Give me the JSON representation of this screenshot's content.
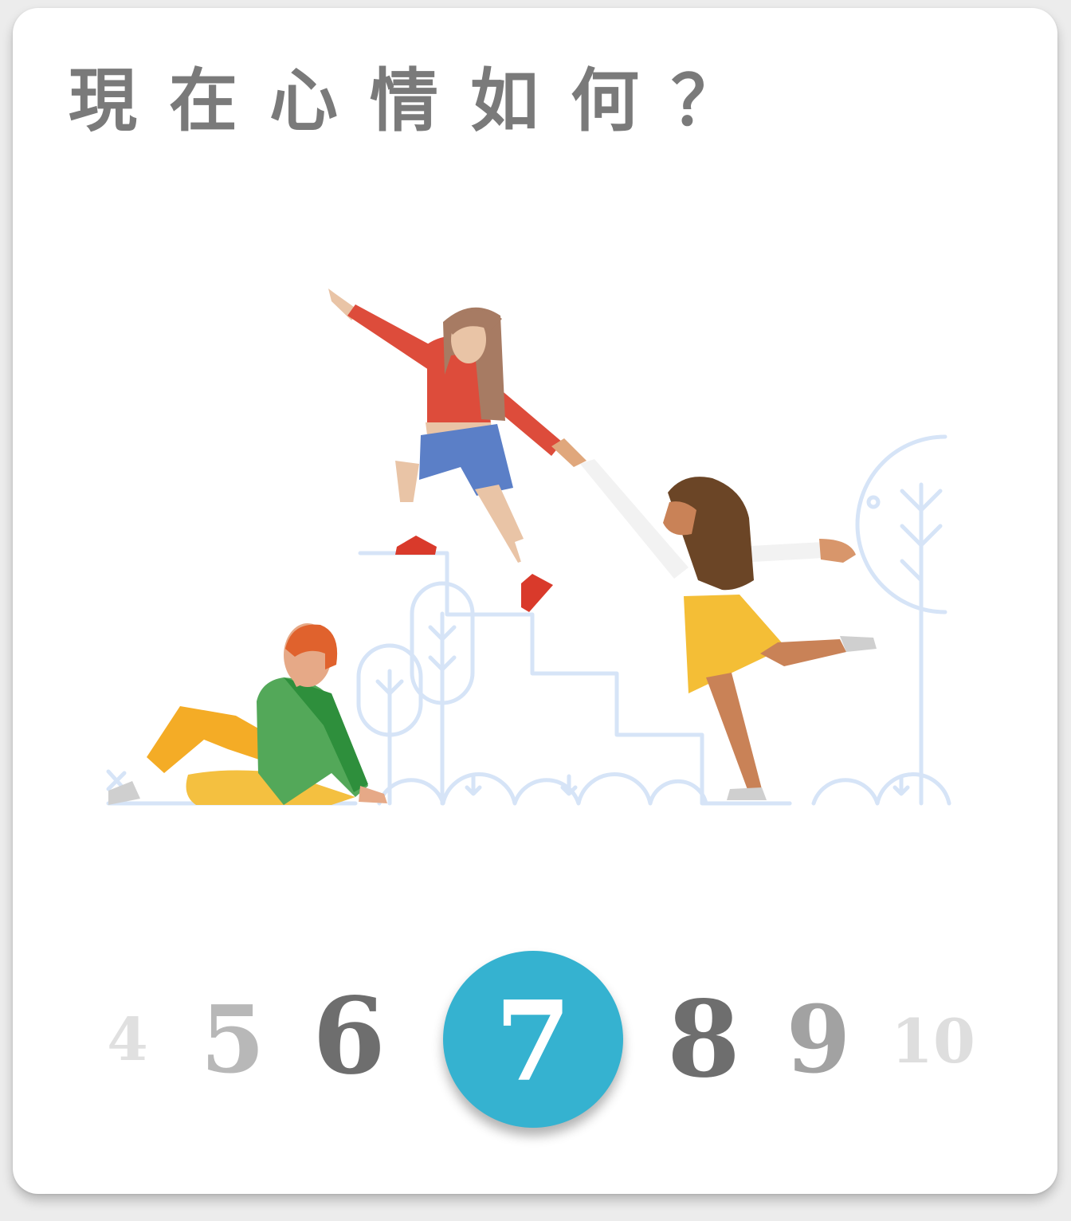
{
  "prompt": {
    "title": "現在心情如何？"
  },
  "illustration": {
    "subject": "people-climbing-stairs-illustration"
  },
  "mood_scale": {
    "options": [
      "4",
      "5",
      "6",
      "7",
      "8",
      "9",
      "10"
    ],
    "selected_value": "7",
    "selected_color": "#35b2d0"
  }
}
